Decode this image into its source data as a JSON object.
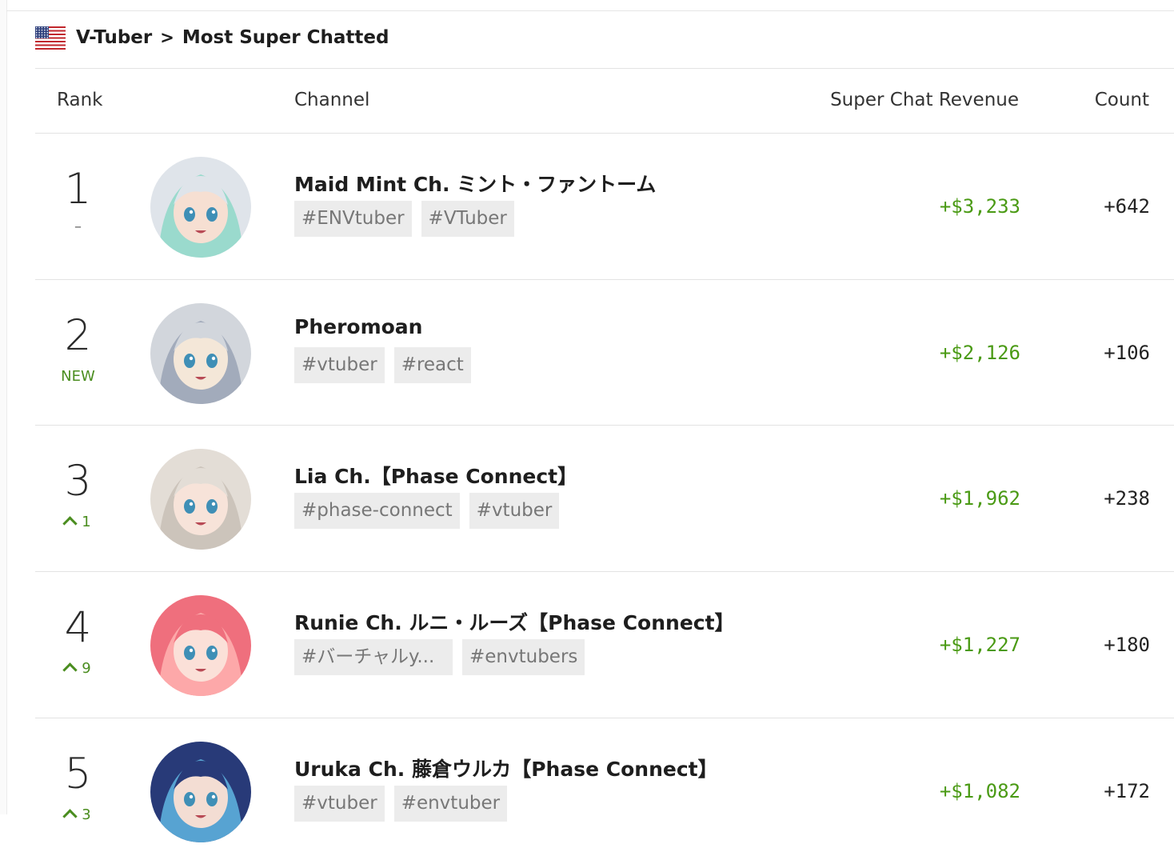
{
  "breadcrumb": {
    "region_flag": "us-flag-icon",
    "category": "V-Tuber",
    "separator": ">",
    "page": "Most Super Chatted"
  },
  "table": {
    "headers": {
      "rank": "Rank",
      "channel": "Channel",
      "revenue": "Super Chat Revenue",
      "count": "Count"
    },
    "rows": [
      {
        "rank": "1",
        "change": "–",
        "change_type": "none",
        "name": "Maid Mint Ch. ミント・ファントーム",
        "tags": [
          "#ENVtuber",
          "#VTuber"
        ],
        "revenue": "+$3,233",
        "count": "+642",
        "avatar_colors": [
          "#dfe4ea",
          "#8ed8c8",
          "#f6dfd2"
        ]
      },
      {
        "rank": "2",
        "change": "NEW",
        "change_type": "new",
        "name": "Pheromoan",
        "tags": [
          "#vtuber",
          "#react"
        ],
        "revenue": "+$2,126",
        "count": "+106",
        "avatar_colors": [
          "#d2d6dc",
          "#9aa3b5",
          "#f4e7d8"
        ]
      },
      {
        "rank": "3",
        "change": "1",
        "change_type": "up",
        "name": "Lia Ch.【Phase Connect】",
        "tags": [
          "#phase-connect",
          "#vtuber"
        ],
        "revenue": "+$1,962",
        "count": "+238",
        "avatar_colors": [
          "#e3ddd6",
          "#c8bfb6",
          "#f7e3d9"
        ]
      },
      {
        "rank": "4",
        "change": "9",
        "change_type": "up",
        "name": "Runie Ch. ルニ・ルーズ【Phase Connect】",
        "tags": [
          "#バーチャルy...",
          "#envtubers"
        ],
        "revenue": "+$1,227",
        "count": "+180",
        "avatar_colors": [
          "#ef6f7d",
          "#ffb3b0",
          "#fbe0d8"
        ]
      },
      {
        "rank": "5",
        "change": "3",
        "change_type": "up",
        "name": "Uruka Ch. 藤倉ウルカ【Phase Connect】",
        "tags": [
          "#vtuber",
          "#envtuber"
        ],
        "revenue": "+$1,082",
        "count": "+172",
        "avatar_colors": [
          "#283a78",
          "#5fb6e2",
          "#f3ddd3"
        ]
      }
    ]
  }
}
